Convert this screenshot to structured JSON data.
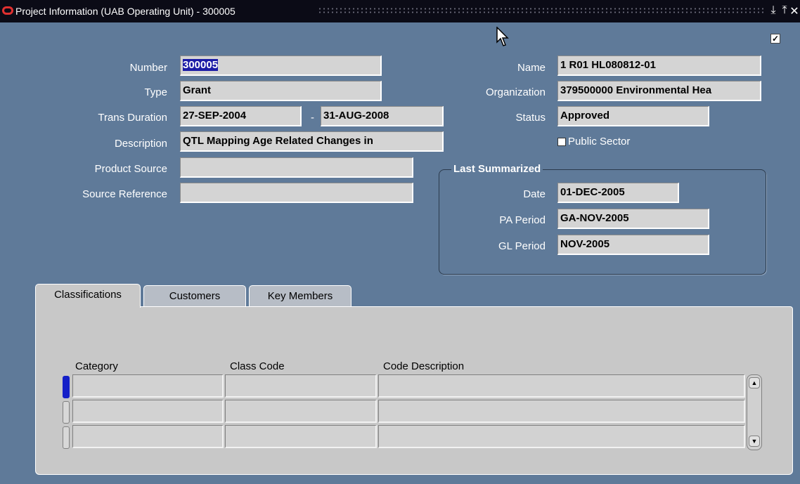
{
  "window": {
    "title": "Project Information (UAB Operating Unit) - 300005",
    "controls": [
      "minimize-icon",
      "maximize-icon",
      "close-icon"
    ]
  },
  "form": {
    "number_label": "Number",
    "number_value": "300005",
    "type_label": "Type",
    "type_value": "Grant",
    "trans_duration_label": "Trans Duration",
    "trans_start": "27-SEP-2004",
    "trans_dash": "-",
    "trans_end": "31-AUG-2008",
    "description_label": "Description",
    "description_value": "QTL Mapping Age Related Changes in",
    "product_source_label": "Product Source",
    "product_source_value": "",
    "source_reference_label": "Source Reference",
    "source_reference_value": "",
    "name_label": "Name",
    "name_value": "1 R01 HL080812-01",
    "organization_label": "Organization",
    "organization_value": "379500000 Environmental Hea",
    "status_label": "Status",
    "status_value": "Approved",
    "public_sector_label": "Public Sector",
    "public_sector_checked": false
  },
  "last_summarized": {
    "title": "Last Summarized",
    "date_label": "Date",
    "date_value": "01-DEC-2005",
    "pa_period_label": "PA Period",
    "pa_period_value": "GA-NOV-2005",
    "gl_period_label": "GL Period",
    "gl_period_value": "NOV-2005"
  },
  "tabs": [
    {
      "label": "Classifications",
      "active": true
    },
    {
      "label": "Customers",
      "active": false
    },
    {
      "label": "Key Members",
      "active": false
    }
  ],
  "table": {
    "columns": [
      "Category",
      "Class Code",
      "Code Description"
    ],
    "rows": [
      [
        "",
        "",
        ""
      ],
      [
        "",
        "",
        ""
      ],
      [
        "",
        "",
        ""
      ]
    ]
  },
  "colors": {
    "background": "#5f7a99",
    "field": "#d4d4d4",
    "titlebar": "#0b0b16",
    "selection": "#1c1ca6",
    "current_row": "#1520c8"
  }
}
